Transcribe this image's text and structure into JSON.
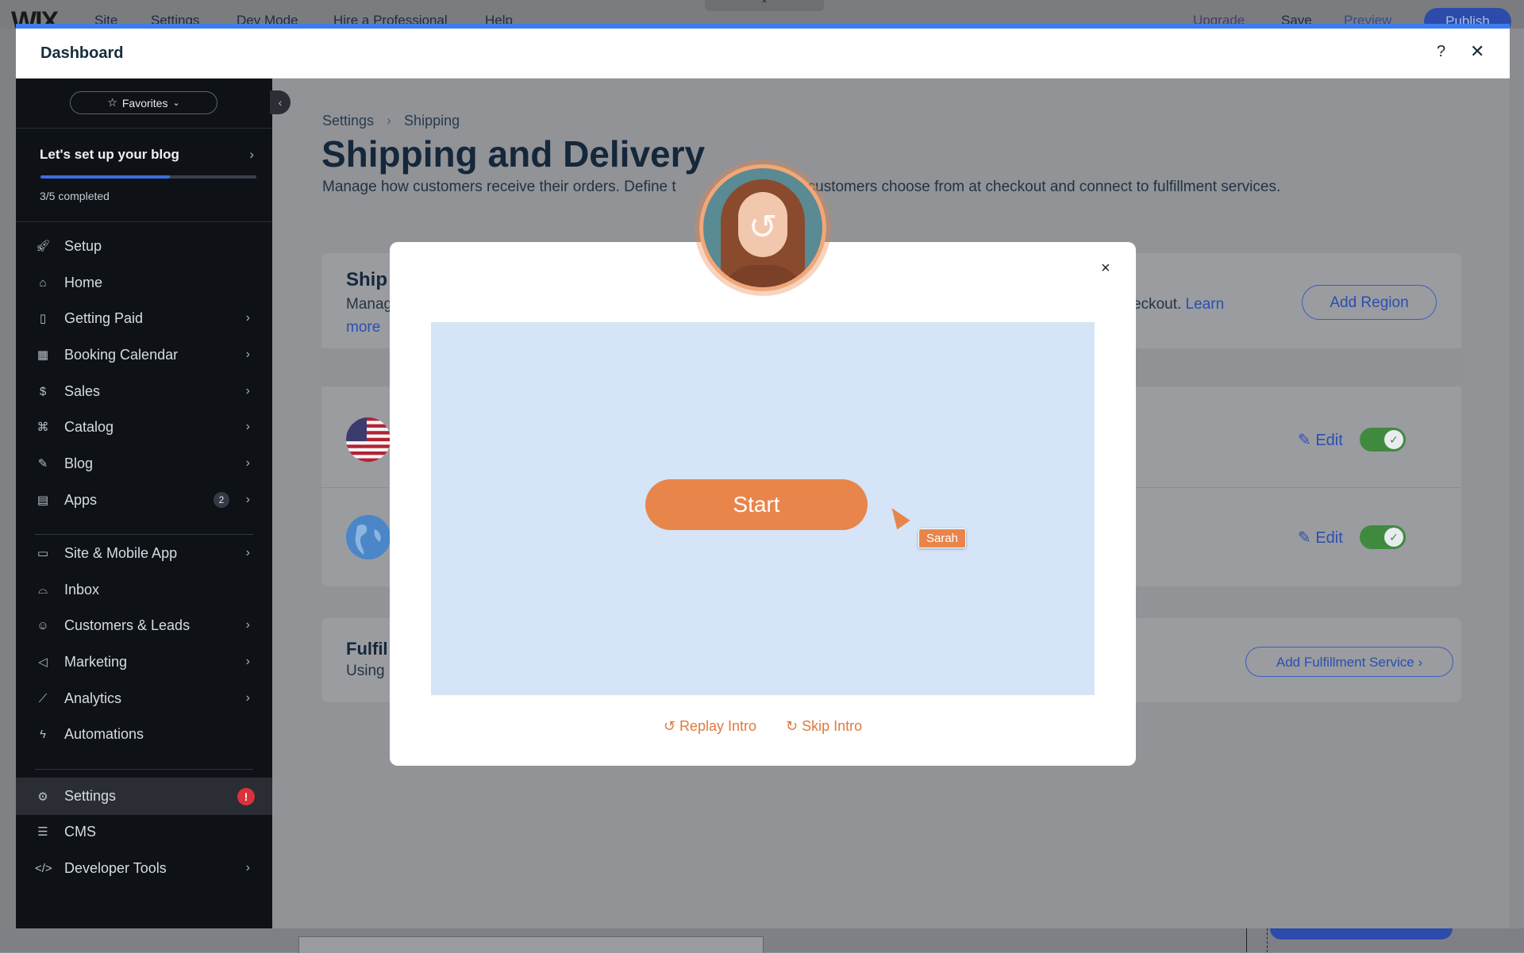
{
  "editor": {
    "logo": "WIX",
    "menu": [
      "Site",
      "Settings",
      "Dev Mode",
      "Hire a Professional",
      "Help"
    ],
    "upgrade": "Upgrade",
    "save": "Save",
    "preview": "Preview",
    "publish": "Publish"
  },
  "dashboard": {
    "title": "Dashboard",
    "help": "?",
    "close": "✕"
  },
  "sidebar": {
    "favorites": "Favorites",
    "setup_title": "Let's set up your blog",
    "progress_label": "3/5 completed",
    "progress": 0.6,
    "items": [
      {
        "label": "Setup",
        "icon": "rocket-icon"
      },
      {
        "label": "Home",
        "icon": "home-icon"
      },
      {
        "label": "Getting Paid",
        "icon": "invoice-icon"
      },
      {
        "label": "Booking Calendar",
        "icon": "calendar-icon"
      },
      {
        "label": "Sales",
        "icon": "dollar-icon"
      },
      {
        "label": "Catalog",
        "icon": "tag-icon"
      },
      {
        "label": "Blog",
        "icon": "pen-icon"
      },
      {
        "label": "Apps",
        "icon": "apps-icon",
        "count": "2"
      },
      {
        "label": "Site & Mobile App",
        "icon": "devices-icon"
      },
      {
        "label": "Inbox",
        "icon": "inbox-icon"
      },
      {
        "label": "Customers & Leads",
        "icon": "people-icon"
      },
      {
        "label": "Marketing",
        "icon": "megaphone-icon"
      },
      {
        "label": "Analytics",
        "icon": "chart-icon"
      },
      {
        "label": "Automations",
        "icon": "bolt-icon"
      },
      {
        "label": "Settings",
        "icon": "gear-icon",
        "alert": "!"
      },
      {
        "label": "CMS",
        "icon": "table-icon"
      },
      {
        "label": "Developer Tools",
        "icon": "code-icon"
      }
    ]
  },
  "main": {
    "breadcrumb": [
      "Settings",
      "Shipping"
    ],
    "title": "Shipping and Delivery",
    "description": "Manage how customers receive their orders. Define the delivery options customers choose from at checkout and connect to fulfillment services.",
    "desc_left": "Manage how customers receive their orders. Define t",
    "desc_right": "ptions customers choose from at checkout and connect to fulfillment services.",
    "shipping_head": "Ship",
    "shipping_sub": "Manag",
    "shipping_more": "more",
    "shipping_learn_prefix": "eckout.",
    "shipping_learn": "Learn",
    "add_region": "Add Region",
    "edit": "Edit",
    "fulfill_head": "Fulfil",
    "fulfill_sub": "Using",
    "add_fulfillment": "Add Fulfillment Service"
  },
  "modal": {
    "close": "×",
    "start": "Start",
    "cursor_name": "Sarah",
    "replay": "Replay Intro",
    "skip": "Skip Intro"
  },
  "colors": {
    "accent": "#3b7df0",
    "orange": "#e8854a",
    "link": "#2a4fb0",
    "toggle_on": "#3f8a3f"
  }
}
